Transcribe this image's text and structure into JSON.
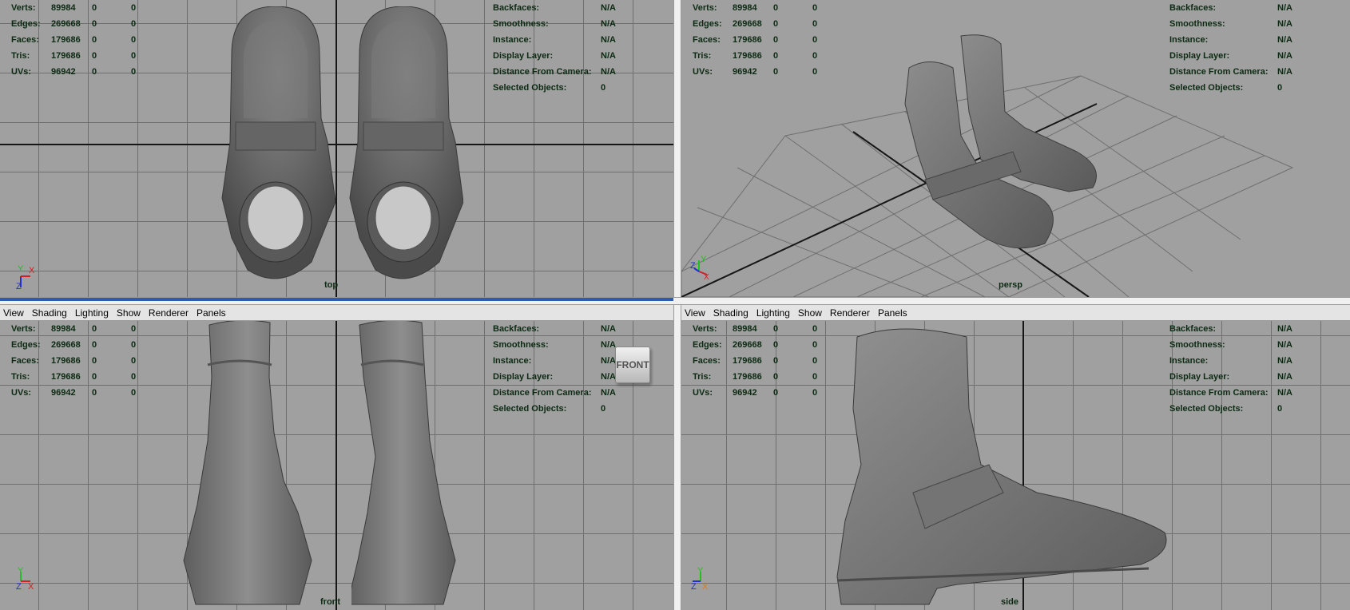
{
  "menu": [
    "View",
    "Shading",
    "Lighting",
    "Show",
    "Renderer",
    "Panels"
  ],
  "stats": [
    {
      "label": "Verts:",
      "a": "89984",
      "b": "0",
      "c": "0"
    },
    {
      "label": "Edges:",
      "a": "269668",
      "b": "0",
      "c": "0"
    },
    {
      "label": "Faces:",
      "a": "179686",
      "b": "0",
      "c": "0"
    },
    {
      "label": "Tris:",
      "a": "179686",
      "b": "0",
      "c": "0"
    },
    {
      "label": "UVs:",
      "a": "96942",
      "b": "0",
      "c": "0"
    }
  ],
  "info": [
    {
      "label": "Backfaces:",
      "value": "N/A"
    },
    {
      "label": "Smoothness:",
      "value": "N/A"
    },
    {
      "label": "Instance:",
      "value": "N/A"
    },
    {
      "label": "Display Layer:",
      "value": "N/A"
    },
    {
      "label": "Distance From Camera:",
      "value": "N/A"
    },
    {
      "label": "Selected Objects:",
      "value": "0"
    }
  ],
  "views": {
    "top": "top",
    "persp": "persp",
    "front": "front",
    "side": "side"
  },
  "view_cube": "FRONT",
  "axes": {
    "x": "X",
    "y": "Y",
    "z": "Z"
  },
  "colors": {
    "viewport_bg": "#a0a0a0",
    "grid": "#6f6f6f",
    "hud_text": "#0c2a12",
    "axis_x": "#d02020",
    "axis_y": "#20c020",
    "axis_z": "#2030d0"
  }
}
